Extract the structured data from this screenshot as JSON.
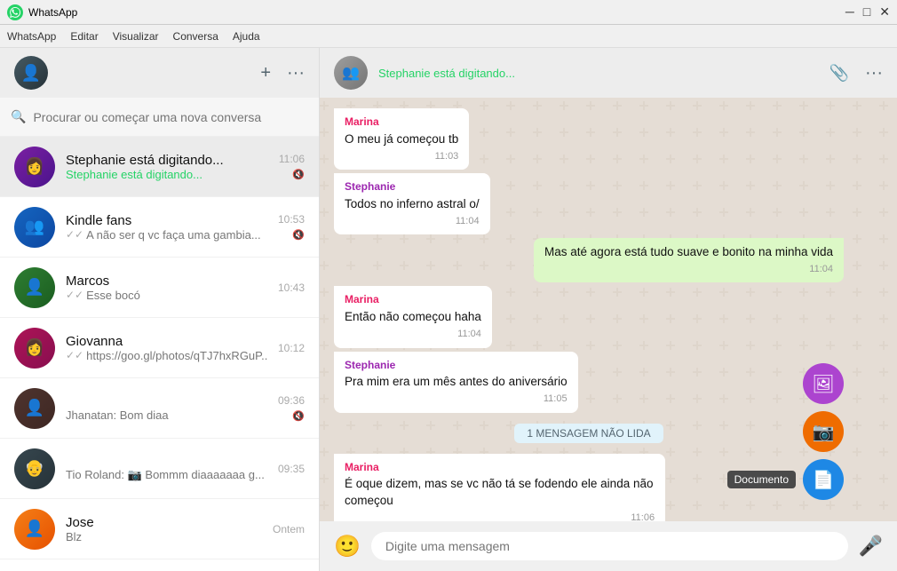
{
  "app": {
    "title": "WhatsApp",
    "titlebar_controls": [
      "—",
      "□",
      "✕"
    ]
  },
  "menubar": {
    "items": [
      "WhatsApp",
      "Editar",
      "Visualizar",
      "Conversa",
      "Ajuda"
    ]
  },
  "left_header": {
    "add_label": "+",
    "more_label": "···"
  },
  "search": {
    "placeholder": "Procurar ou começar uma nova conversa"
  },
  "chats": [
    {
      "id": "stephanie",
      "name": "Stephanie está digitando...",
      "preview": "Stephanie está digitando...",
      "time": "11:06",
      "typing": true,
      "active": true,
      "muted": true
    },
    {
      "id": "kindle",
      "name": "Kindle fans",
      "preview": "A não ser q vc faça uma gambia...",
      "time": "10:53",
      "typing": false,
      "double_check": true,
      "muted": true
    },
    {
      "id": "marcos",
      "name": "Marcos",
      "preview": "Esse bocó",
      "time": "10:43",
      "typing": false,
      "double_check": true,
      "muted": false
    },
    {
      "id": "giovanna",
      "name": "Giovanna",
      "preview": "https://goo.gl/photos/qTJ7hxRGuP...",
      "time": "10:12",
      "typing": false,
      "double_check": true,
      "muted": false
    },
    {
      "id": "jhanatan",
      "name": "",
      "preview": "Jhanatan: Bom diaa",
      "time": "09:36",
      "typing": false,
      "double_check": false,
      "muted": true
    },
    {
      "id": "tio",
      "name": "",
      "preview": "Tio Roland: 📷 Bommm diaaaaaaa g...",
      "time": "09:35",
      "typing": false,
      "double_check": false,
      "muted": false
    },
    {
      "id": "jose",
      "name": "Jose",
      "preview": "Blz",
      "time": "Ontem",
      "typing": false,
      "double_check": false,
      "muted": false
    }
  ],
  "right_header": {
    "status": "Stephanie está digitando...",
    "attachment_label": "📎",
    "more_label": "···"
  },
  "messages": [
    {
      "id": 1,
      "sender": "Marina",
      "sender_class": "marina",
      "text": "O meu já começou tb",
      "time": "11:03",
      "type": "incoming"
    },
    {
      "id": 2,
      "sender": "Stephanie",
      "sender_class": "stephanie",
      "text": "Todos no inferno astral o/",
      "time": "11:04",
      "type": "incoming"
    },
    {
      "id": 3,
      "sender": "",
      "text": "Mas até agora está tudo suave e bonito na minha vida",
      "time": "11:04",
      "type": "outgoing"
    },
    {
      "id": 4,
      "sender": "Marina",
      "sender_class": "marina",
      "text": "Então não começou haha",
      "time": "11:04",
      "type": "incoming"
    },
    {
      "id": 5,
      "sender": "Stephanie",
      "sender_class": "stephanie",
      "text": "Pra mim era um mês antes do aniversário",
      "time": "11:05",
      "type": "incoming"
    }
  ],
  "unread_divider": "1 MENSAGEM NÃO LIDA",
  "message_after_divider": {
    "sender": "Marina",
    "sender_class": "marina",
    "text": "É oque dizem, mas se vc não tá se fodendo ele ainda não começou",
    "time": "11:06",
    "type": "incoming"
  },
  "attachment_options": [
    {
      "id": "gallery",
      "label": "",
      "icon": "🖼"
    },
    {
      "id": "camera",
      "label": "",
      "icon": "📷"
    },
    {
      "id": "document",
      "label": "Documento",
      "icon": "📄"
    }
  ],
  "input": {
    "placeholder": "Digite uma mensagem"
  }
}
